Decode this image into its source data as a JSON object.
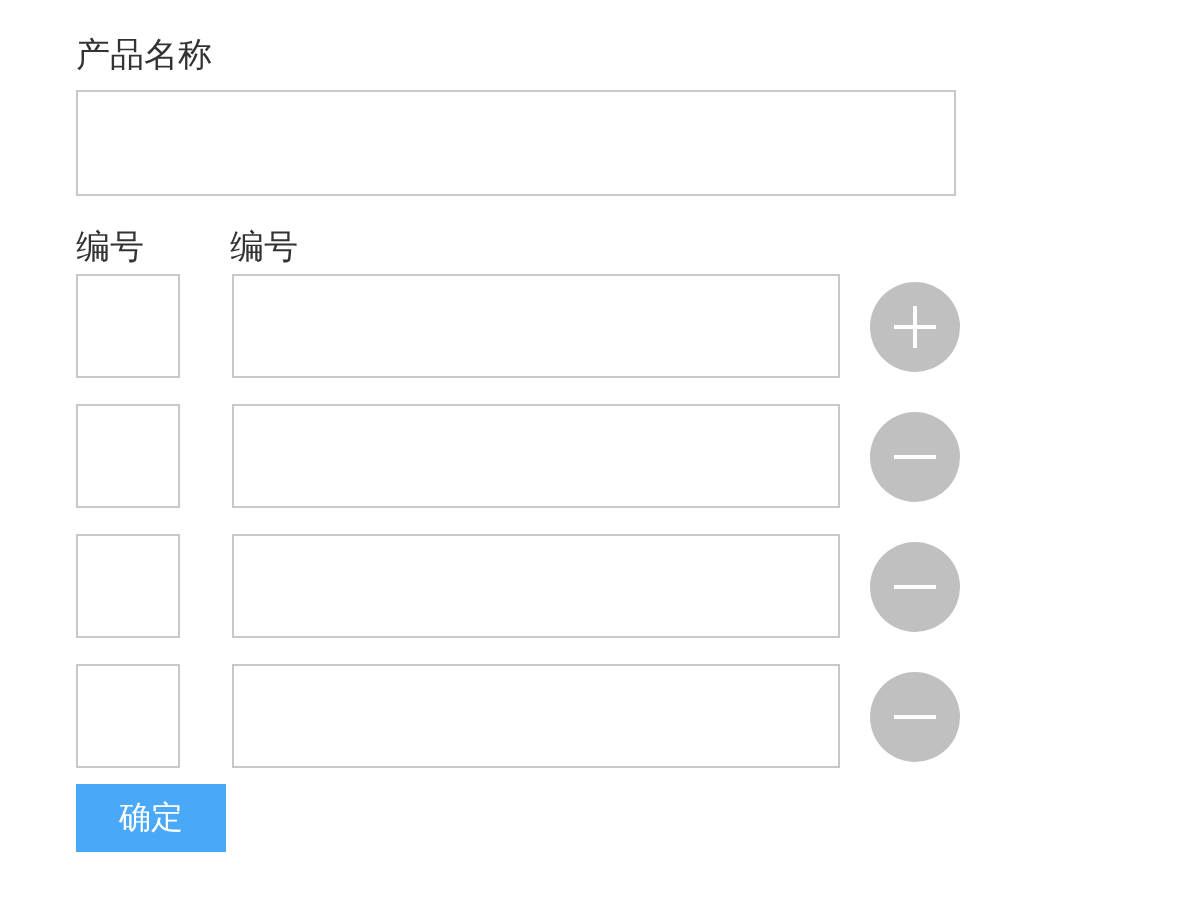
{
  "product_name": {
    "label": "产品名称"
  },
  "columns": [
    "编号",
    "编号"
  ],
  "rows": [
    {
      "kind": "add"
    },
    {
      "kind": "remove"
    },
    {
      "kind": "remove"
    },
    {
      "kind": "remove"
    }
  ],
  "submit_button": {
    "label": "确定"
  }
}
